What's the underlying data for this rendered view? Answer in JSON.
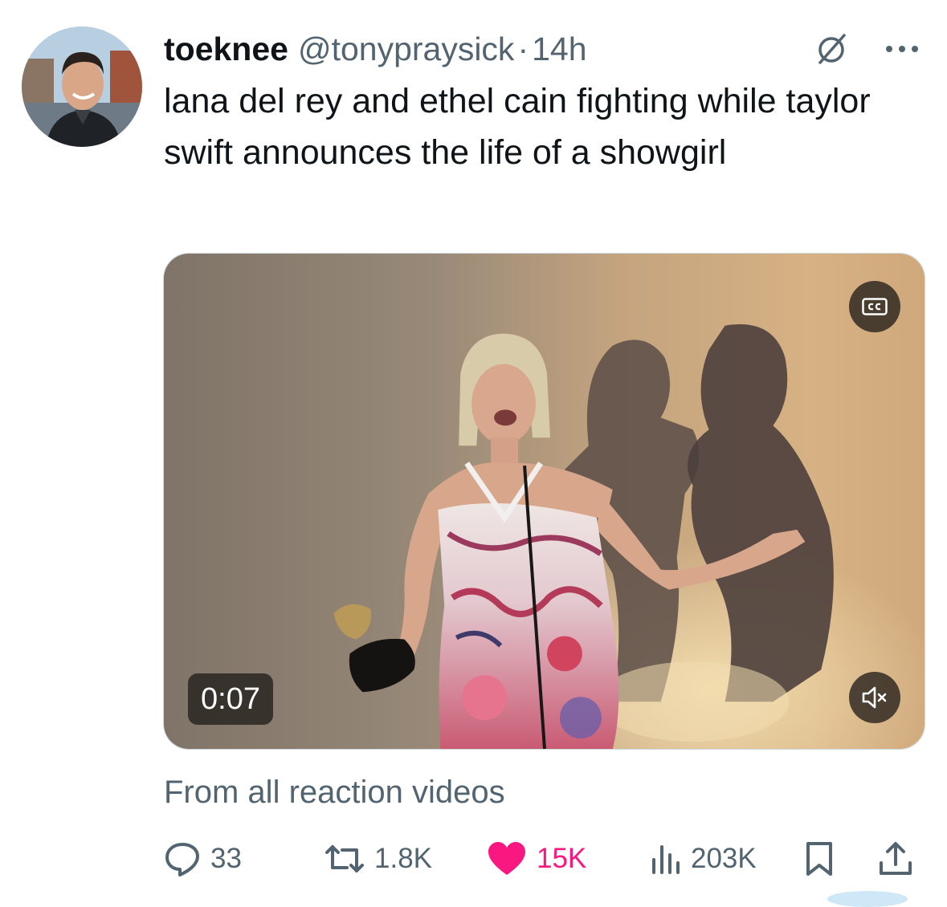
{
  "author": {
    "display_name": "toeknee",
    "handle": "@tonypraysick",
    "separator": "·",
    "time": "14h"
  },
  "tweet": {
    "text": "lana del rey and ethel cain fighting while taylor swift announces the life of a showgirl"
  },
  "media": {
    "duration": "0:07",
    "cc_label": "CC",
    "source_label": "From all reaction videos"
  },
  "actions": {
    "replies": "33",
    "retweets": "1.8K",
    "likes": "15K",
    "views": "203K"
  },
  "colors": {
    "text": "#0f1419",
    "secondary": "#536471",
    "like": "#f91880",
    "border": "#cfd9de"
  },
  "icons": {
    "header": [
      "badge-icon",
      "more-icon"
    ],
    "media": [
      "cc-icon",
      "mute-icon"
    ],
    "actions": [
      "reply-icon",
      "retweet-icon",
      "heart-icon",
      "views-icon",
      "bookmark-icon",
      "share-icon"
    ]
  }
}
